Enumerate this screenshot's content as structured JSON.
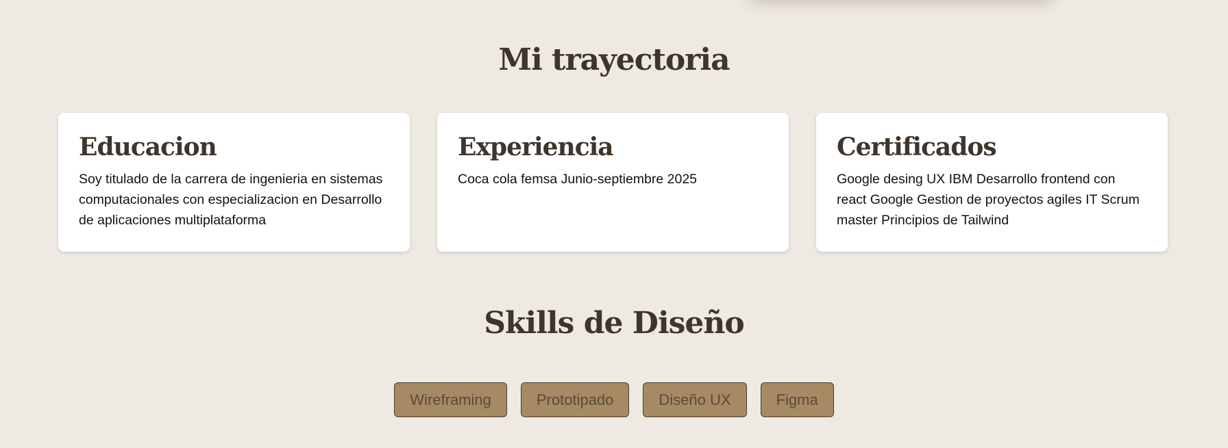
{
  "trajectory": {
    "title": "Mi trayectoria",
    "cards": [
      {
        "title": "Educacion",
        "text": "Soy titulado de la carrera de ingenieria en sistemas computacionales con especializacion en Desarrollo de aplicaciones multiplataforma"
      },
      {
        "title": "Experiencia",
        "text": "Coca cola femsa Junio-septiembre 2025"
      },
      {
        "title": "Certificados",
        "text": "Google desing UX IBM Desarrollo frontend con react Google Gestion de proyectos agiles IT Scrum master Principios de Tailwind"
      }
    ]
  },
  "skills": {
    "title": "Skills de Diseño",
    "items": [
      "Wireframing",
      "Prototipado",
      "Diseño UX",
      "Figma"
    ]
  }
}
